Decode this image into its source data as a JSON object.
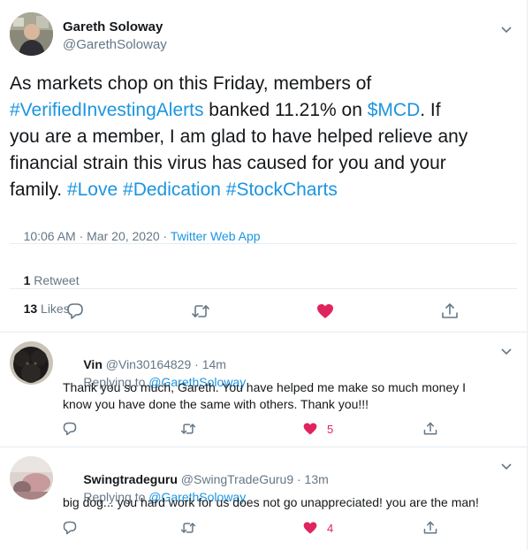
{
  "tweet": {
    "author_name": "Gareth Soloway",
    "author_handle": "@GarethSoloway",
    "text_1": "As markets chop on this Friday, members of",
    "hashtag_1": "#VerifiedInvestingAlerts",
    "text_2": " banked 11.21% on ",
    "cashtag": "$MCD",
    "text_3": ". If",
    "line3": "you are a member, I am glad to have helped relieve any",
    "line4": "financial strain this virus has caused for you and your",
    "line5_text": "family. ",
    "hashtag_love": "#Love",
    "hashtag_dedication": "#Dedication",
    "hashtag_stockcharts": "#StockCharts",
    "timestamp": "10:06 AM · Mar 20, 2020 · ",
    "source": "Twitter Web App",
    "retweet_count": "1",
    "retweet_label": "Retweet",
    "like_count": "13",
    "like_label": "Likes"
  },
  "replies": [
    {
      "name": "Vin",
      "handle": "@Vin30164829",
      "time": "· 14m",
      "replying_to_label": "Replying to ",
      "replying_to_handle": "@GarethSoloway",
      "text_line1": "Thank you so much, Gareth. You have helped me make so much money I",
      "text_line2": "know you have done the same with others. Thank you!!!",
      "like_count": "5"
    },
    {
      "name": "Swingtradeguru",
      "handle": "@SwingTradeGuru9",
      "time": "· 13m",
      "replying_to_label": "Replying to ",
      "replying_to_handle": "@GarethSoloway",
      "text_line1": "big dog... you hard work for us does not go unappreciated! you are the man!",
      "like_count": "4"
    }
  ],
  "colors": {
    "link": "#1b95e0",
    "like_red": "#e0245e",
    "muted": "#657786",
    "divider": "#e6ecf0"
  },
  "icons": [
    "chevron-down-icon",
    "reply-icon",
    "retweet-icon",
    "heart-icon",
    "share-icon"
  ]
}
